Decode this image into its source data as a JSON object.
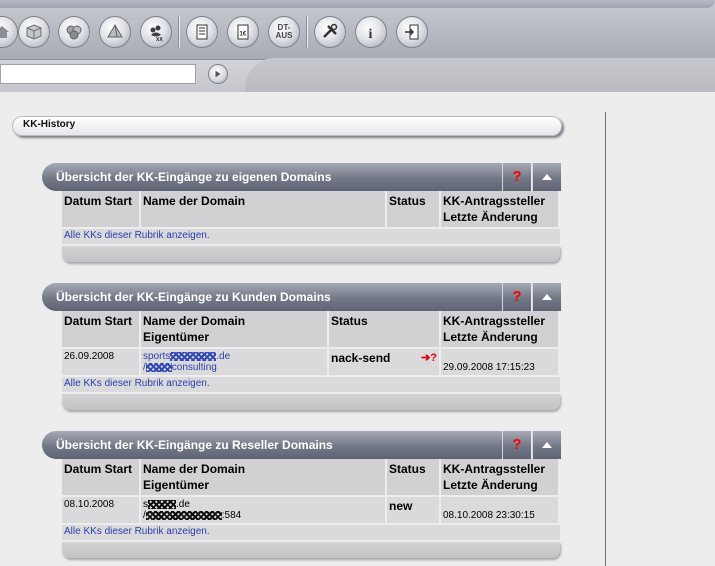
{
  "toolbar": {
    "buttons": [
      {
        "name": "home-icon"
      },
      {
        "name": "box-icon"
      },
      {
        "name": "spheres-icon"
      },
      {
        "name": "pyramid-icon"
      },
      {
        "name": "paw-icon",
        "label": "XX"
      },
      {
        "name": "document-list-icon"
      },
      {
        "name": "invoice-icon",
        "label": "1€"
      },
      {
        "name": "dt-aus-icon",
        "label": "DT-AUS"
      },
      {
        "name": "tools-icon"
      },
      {
        "name": "info-icon"
      },
      {
        "name": "logout-icon"
      }
    ]
  },
  "search": {
    "value": "",
    "placeholder": ""
  },
  "breadcrumb": {
    "title": "KK-History"
  },
  "sections": [
    {
      "title": "Übersicht der KK-Eingänge zu eigenen Domains",
      "help": "?",
      "headers": [
        "Datum Start",
        "Name der Domain",
        "Status",
        "KK-Antragssteller Letzte Änderung"
      ],
      "rows": [],
      "show_all": "Alle KKs dieser Rubrik anzeigen."
    },
    {
      "title": "Übersicht der KK-Eingänge zu Kunden Domains",
      "help": "?",
      "headers": [
        "Datum Start",
        "Name der Domain Eigentümer",
        "Status",
        "KK-Antragssteller Letzte Änderung"
      ],
      "rows": [
        {
          "date": "26.09.2008",
          "domain_prefix": "sports",
          "domain_suffix": ".de",
          "owner_prefix": "/",
          "owner_suffix": "consulting",
          "status": "nack-send",
          "status_icon": "➔?",
          "changed": "29.09.2008 17:15:23"
        }
      ],
      "show_all": "Alle KKs dieser Rubrik anzeigen."
    },
    {
      "title": "Übersicht der KK-Eingänge zu Reseller Domains",
      "help": "?",
      "headers": [
        "Datum Start",
        "Name der Domain Eigentümer",
        "Status",
        "KK-Antragssteller Letzte Änderung"
      ],
      "rows": [
        {
          "date": "08.10.2008",
          "domain_prefix": "s",
          "domain_suffix": ".de",
          "owner_prefix": "/",
          "owner_suffix": ":584",
          "status": "new",
          "changed": "08.10.2008 23:30:15"
        }
      ],
      "show_all": "Alle KKs dieser Rubrik anzeigen."
    }
  ],
  "colors": {
    "link": "#2a3ea8",
    "help": "#ff0000",
    "header": "#737887"
  }
}
